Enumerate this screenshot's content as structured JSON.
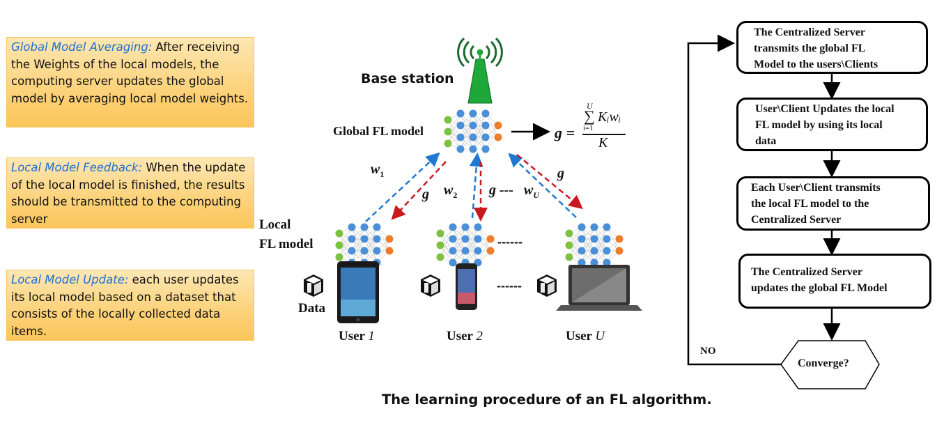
{
  "notes": [
    {
      "heading": "Global Model Averaging:",
      "body": " After receiving the Weights of the local models, the computing server updates the global model by averaging local model weights."
    },
    {
      "heading": "Local Model Feedback:",
      "body": " When the update of the local model is finished, the results should be transmitted to the computing server"
    },
    {
      "heading": "Local Model Update:",
      "body": " each user updates its local model based on a dataset that consists of the locally collected data items."
    }
  ],
  "diagram": {
    "base_station_label": "Base station",
    "global_model_label": "Global FL model",
    "formula": {
      "lhs": "g =",
      "sum_upper": "U",
      "sum_lower": "i=1",
      "numerator_term": "Kᵢwᵢ",
      "denominator": "K"
    },
    "local_model_label_line1": "Local",
    "local_model_label_line2": "FL model",
    "data_label": "Data",
    "ellipsis": "------",
    "arrow_labels": {
      "w1": "w",
      "w1_sub": "1",
      "g1": "g",
      "w2": "w",
      "w2_sub": "2",
      "g2": "g ---",
      "wU": "w",
      "wU_sub": "U",
      "gU": "g"
    },
    "users": [
      {
        "prefix": "User ",
        "index": "1",
        "device": "tablet"
      },
      {
        "prefix": "User ",
        "index": "2",
        "device": "phone"
      },
      {
        "prefix": "User ",
        "index": "U",
        "device": "laptop"
      }
    ],
    "colors": {
      "upload_arrow": "#1f78d1",
      "download_arrow": "#c8191f",
      "tower": "#1fa83a",
      "input_node": "#7cc142",
      "hidden_node": "#4a90d9",
      "output_node": "#ee7d2b"
    }
  },
  "flowchart": {
    "steps": [
      [
        "The Centralized Server",
        "transmits the global FL",
        "Model to the users\\Clients"
      ],
      [
        "User\\Client Updates the local",
        "FL model by using its local",
        "data"
      ],
      [
        "Each User\\Client transmits",
        "the local FL model to the",
        "Centralized Server"
      ],
      [
        "The Centralized Server",
        "updates the global FL Model"
      ]
    ],
    "decision": "Converge?",
    "loop_label": "NO"
  },
  "caption": "The learning procedure of an FL algorithm."
}
